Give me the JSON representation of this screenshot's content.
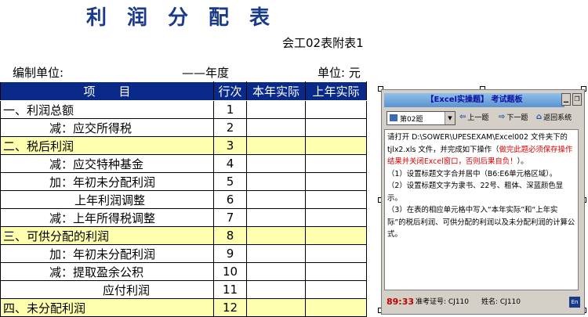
{
  "header": {
    "title": "利润分配表",
    "subtitle": "会工02表附表1",
    "unit_label": "编制单位:",
    "year_label": "——年度",
    "currency_label": "单位: 元"
  },
  "table": {
    "columns": [
      "项　　目",
      "行次",
      "本年实际",
      "上年实际"
    ],
    "rows": [
      {
        "item": "一、利润总额",
        "line": "1"
      },
      {
        "item": "减：应交所得税",
        "line": "2"
      },
      {
        "item": "二、税后利润",
        "line": "3"
      },
      {
        "item": "减：应交特种基金",
        "line": "4"
      },
      {
        "item": "加：年初未分配利润",
        "line": "5"
      },
      {
        "item": "上年利润调整",
        "line": "6"
      },
      {
        "item": "减：上年所得税调整",
        "line": "7"
      },
      {
        "item": "三、可供分配的利润",
        "line": "8"
      },
      {
        "item": "加：年初未分配利润",
        "line": "9"
      },
      {
        "item": "减：提取盈余公积",
        "line": "10"
      },
      {
        "item": "应付利润",
        "line": "11"
      },
      {
        "item": "四、未分配利润",
        "line": "12"
      }
    ]
  },
  "panel": {
    "title": "【Excel实操题】 考试题板",
    "question_select": "第02题",
    "prev_label": "上一题",
    "next_label": "下一题",
    "back_label": "返回系统",
    "body_p1": "请打开 D:\\SOWER\\UPESEXAM\\Excel002 文件夹下的 tjlx2.xls 文件，并完成如下操作（",
    "body_red": "做完此题必须保存操作结果并关闭Excel窗口，否则后果自负！",
    "body_p2": "）。\n（1）设置标题文字合并居中（B6:E6单元格区域）。\n（2）设置标题文字为隶书、22号、粗体、深蓝颜色显示。\n（3）在表的相应单元格中写入“本年实际”和“上年实际”的税后利润、可供分配的利润以及未分配利润的计算公式。",
    "timer": "89:33",
    "exam_id": "准考证号: CJ110",
    "name": "姓名: CJ110",
    "lang_btn": "En"
  },
  "colors": {
    "header_bg": "#0a2a8a",
    "highlight_row": "#ffffb0",
    "title_color": "#1a3a8a"
  }
}
